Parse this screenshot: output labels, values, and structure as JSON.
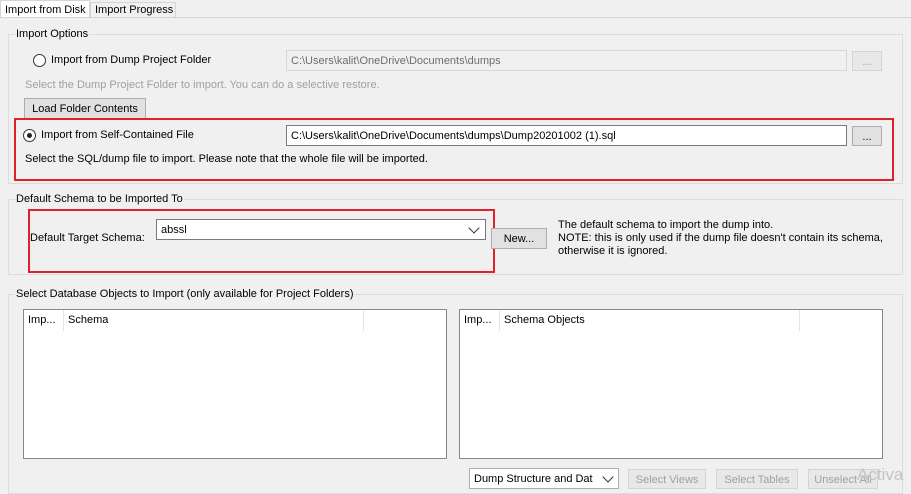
{
  "tabs": [
    {
      "label": "Import from Disk"
    },
    {
      "label": "Import Progress"
    }
  ],
  "import_options": {
    "title": "Import Options",
    "dump_folder": {
      "label": "Import from Dump Project Folder",
      "path": "C:\\Users\\kalit\\OneDrive\\Documents\\dumps",
      "browse_label": "...",
      "hint": "Select the Dump Project Folder to import. You can do a selective restore.",
      "load_button": "Load Folder Contents"
    },
    "self_contained": {
      "label": "Import from Self-Contained File",
      "path": "C:\\Users\\kalit\\OneDrive\\Documents\\dumps\\Dump20201002 (1).sql",
      "browse_label": "...",
      "hint": "Select the SQL/dump file to import. Please note that the whole file will be imported."
    }
  },
  "default_schema": {
    "title": "Default Schema to be Imported To",
    "target_label": "Default Target Schema:",
    "selected": "abssl",
    "new_button": "New...",
    "note_lines": [
      "The default schema to import the dump into.",
      "NOTE: this is only used if the dump file doesn't contain its schema,",
      "otherwise it is ignored."
    ]
  },
  "objects": {
    "title": "Select Database Objects to Import (only available for Project Folders)",
    "left_list": {
      "col1": "Imp...",
      "col2": "Schema"
    },
    "right_list": {
      "col1": "Imp...",
      "col2": "Schema Objects"
    }
  },
  "bottom": {
    "dump_select": "Dump Structure and Dat",
    "select_views": "Select Views",
    "select_tables": "Select Tables",
    "unselect_all": "Unselect All",
    "watermark": "Activa"
  }
}
